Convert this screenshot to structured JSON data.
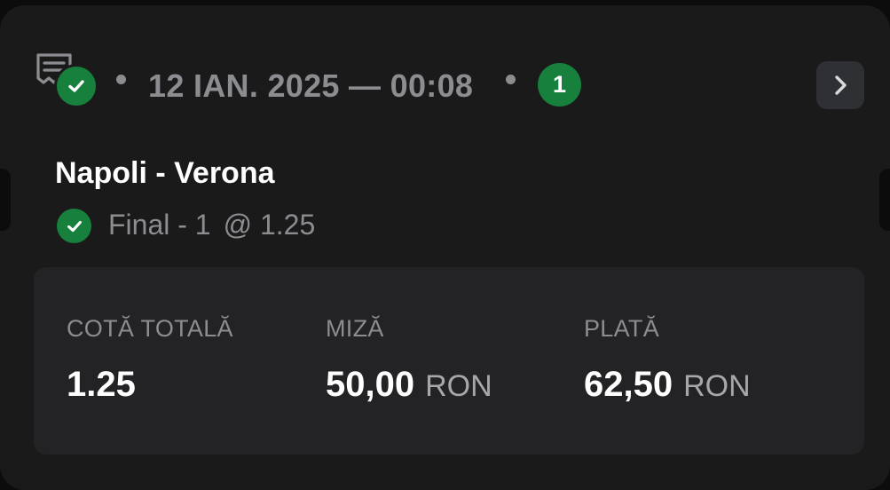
{
  "header": {
    "ticket_icon": "receipt-icon",
    "status_icon": "check-icon",
    "date_time": "12 IAN. 2025 — 00:08",
    "selections_count": "1",
    "open_icon": "chevron-right-icon"
  },
  "event": {
    "match": "Napoli - Verona",
    "status_icon": "check-icon",
    "market": "Final - 1",
    "odds": "@ 1.25"
  },
  "summary": {
    "total_odds_label": "COTĂ TOTALĂ",
    "total_odds_value": "1.25",
    "stake_label": "MIZĂ",
    "stake_value": "50,00",
    "stake_currency": "RON",
    "payout_label": "PLATĂ",
    "payout_value": "62,50",
    "payout_currency": "RON"
  },
  "colors": {
    "background": "#1a1a1b",
    "accent_green": "#17803d",
    "muted_text": "#8c8d90",
    "panel": "#232325"
  }
}
